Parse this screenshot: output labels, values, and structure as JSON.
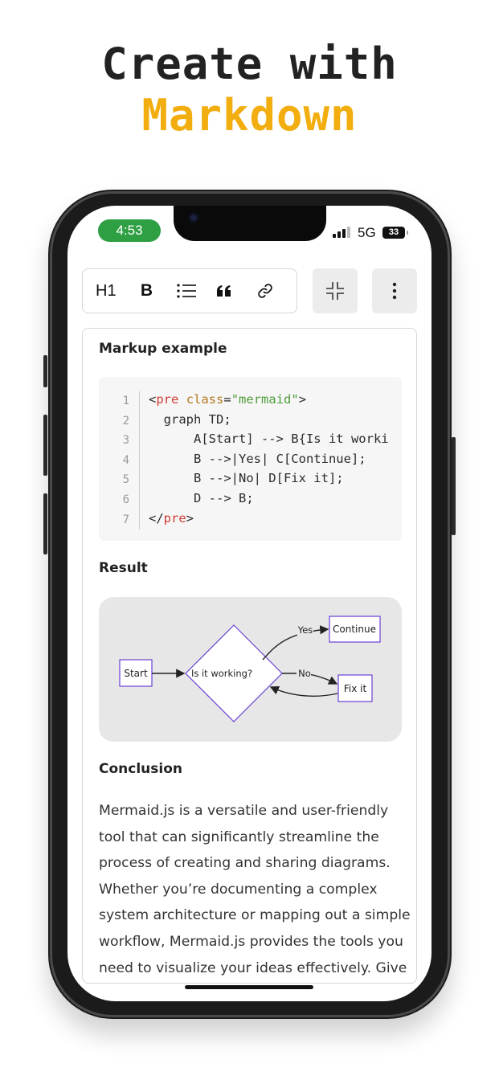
{
  "hero": {
    "line1": "Create with",
    "line2": "Markdown"
  },
  "status": {
    "time": "4:53",
    "network": "5G",
    "battery": "33"
  },
  "toolbar": {
    "heading_label": "H1",
    "bold_label": "B",
    "list_icon": "bullet-list-icon",
    "quote_icon": "quote-icon",
    "link_icon": "link-icon",
    "collapse_icon": "collapse-icon",
    "more_icon": "more-vertical-icon"
  },
  "document": {
    "section1_title": "Markup example",
    "code_lines": [
      {
        "n": "1",
        "parts": [
          {
            "t": "<",
            "c": ""
          },
          {
            "t": "pre",
            "c": "tag"
          },
          {
            "t": " ",
            "c": ""
          },
          {
            "t": "class",
            "c": "attr"
          },
          {
            "t": "=",
            "c": ""
          },
          {
            "t": "\"mermaid\"",
            "c": "str"
          },
          {
            "t": ">",
            "c": ""
          }
        ]
      },
      {
        "n": "2",
        "parts": [
          {
            "t": "  graph TD;",
            "c": ""
          }
        ]
      },
      {
        "n": "3",
        "parts": [
          {
            "t": "      A[Start] --> B{Is it worki",
            "c": ""
          }
        ]
      },
      {
        "n": "4",
        "parts": [
          {
            "t": "      B -->|Yes| C[Continue];",
            "c": ""
          }
        ]
      },
      {
        "n": "5",
        "parts": [
          {
            "t": "      B -->|No| D[Fix it];",
            "c": ""
          }
        ]
      },
      {
        "n": "6",
        "parts": [
          {
            "t": "      D --> B;",
            "c": ""
          }
        ]
      },
      {
        "n": "7",
        "parts": [
          {
            "t": "</",
            "c": ""
          },
          {
            "t": "pre",
            "c": "tag"
          },
          {
            "t": ">",
            "c": ""
          }
        ]
      }
    ],
    "section2_title": "Result",
    "diagram": {
      "start": "Start",
      "decision": "Is it working?",
      "yes_label": "Yes",
      "no_label": "No",
      "continue": "Continue",
      "fix": "Fix it"
    },
    "section3_title": "Conclusion",
    "conclusion_lines": [
      "Mermaid.js is a versatile and user-friendly",
      "tool that can significantly streamline the",
      "process of creating and sharing diagrams.",
      "Whether you’re documenting a complex",
      "system architecture or mapping out a simple",
      "workflow, Mermaid.js provides the tools you",
      "need to visualize your ideas effectively. Give"
    ]
  },
  "colors": {
    "accent_yellow": "#f2ad0f",
    "time_pill": "#2ea043",
    "diagram_stroke": "#6b3fd6"
  }
}
